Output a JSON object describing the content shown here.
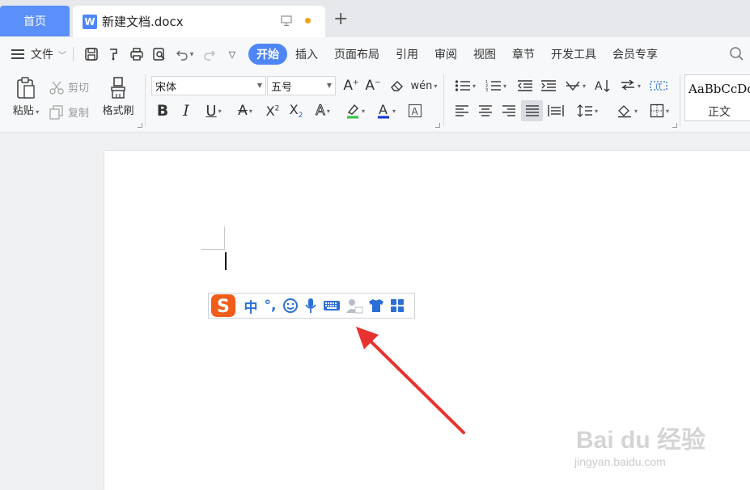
{
  "tabs": {
    "home": "首页",
    "doc_title": "新建文档.docx",
    "doc_icon_letter": "W"
  },
  "menu": {
    "file": "文件",
    "tabs": [
      "开始",
      "插入",
      "页面布局",
      "引用",
      "审阅",
      "视图",
      "章节",
      "开发工具",
      "会员专享"
    ],
    "active_tab": "开始"
  },
  "clipboard": {
    "paste": "粘贴",
    "cut": "剪切",
    "copy": "复制",
    "format_painter": "格式刷"
  },
  "font": {
    "family": "宋体",
    "size": "五号",
    "phonetic": "wén"
  },
  "styles": {
    "sample": "AaBbCcDd",
    "name": "正文"
  },
  "ime": {
    "mode": "中",
    "punct": "°,"
  },
  "watermark": {
    "brand": "Bai du 经验",
    "url": "jingyan.baidu.com"
  },
  "colors": {
    "accent": "#4e86f6",
    "arrow": "#e8322f",
    "ime_blue": "#2b6fd6",
    "sogou_orange": "#f25c1b"
  }
}
